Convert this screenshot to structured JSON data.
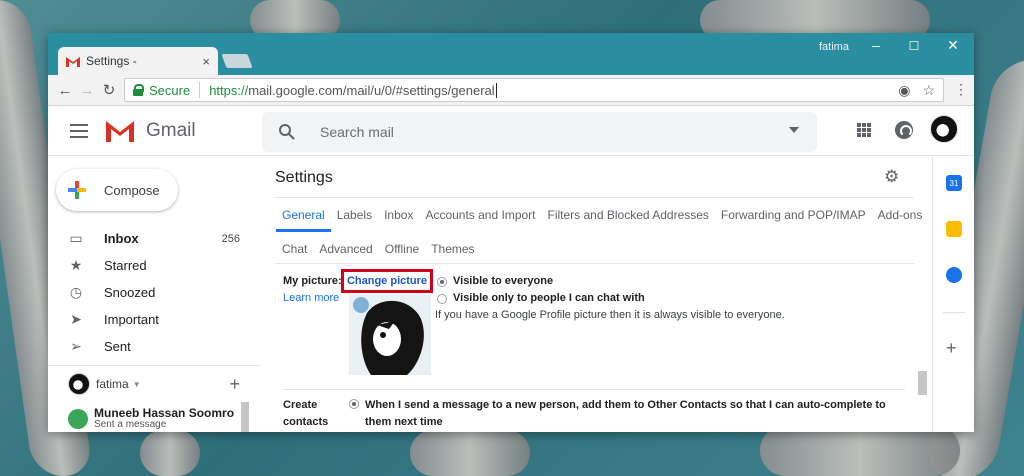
{
  "browser": {
    "tab_title": "Settings - ",
    "tab_close": "×",
    "user": "fatima",
    "minimize": "–",
    "maximize": "☐",
    "close": "✕",
    "back": "←",
    "forward": "→",
    "reload": "↻",
    "secure_label": "Secure",
    "url_scheme": "https://",
    "url_host": "mail.google.com",
    "url_path": "/mail/u/0/#settings/general",
    "menu": "⋮"
  },
  "gmail": {
    "brand": "Gmail",
    "search_placeholder": "Search mail",
    "compose": "Compose",
    "nav": [
      {
        "label": "Inbox",
        "count": "256",
        "icon": "inbox-icon",
        "glyph": "▭"
      },
      {
        "label": "Starred",
        "count": "",
        "icon": "star-icon",
        "glyph": "★"
      },
      {
        "label": "Snoozed",
        "count": "",
        "icon": "clock-icon",
        "glyph": "◷"
      },
      {
        "label": "Important",
        "count": "",
        "icon": "important-icon",
        "glyph": "➤"
      },
      {
        "label": "Sent",
        "count": "",
        "icon": "send-icon",
        "glyph": "➢"
      }
    ],
    "hangouts_user": "fatima",
    "hangouts_plus": "+",
    "contact": {
      "name": "Muneeb Hassan Soomro",
      "status": "Sent a message"
    }
  },
  "settings": {
    "title": "Settings",
    "tabs_row1": [
      "General",
      "Labels",
      "Inbox",
      "Accounts and Import",
      "Filters and Blocked Addresses",
      "Forwarding and POP/IMAP",
      "Add-ons"
    ],
    "tabs_row2": [
      "Chat",
      "Advanced",
      "Offline",
      "Themes"
    ],
    "my_picture_label": "My picture:",
    "change_picture": "Change picture",
    "learn_more": "Learn more",
    "visible_everyone": "Visible to everyone",
    "visible_chat": "Visible only to people I can chat with",
    "picture_note": "If you have a Google Profile picture then it is always visible to everyone.",
    "create_contacts_label": "Create contacts for",
    "create_contacts_option": "When I send a message to a new person, add them to Other Contacts so that I can auto-complete to them next time"
  },
  "rightbar": {
    "calendar_text": "31",
    "plus": "+"
  },
  "colors": {
    "accent": "#1a73e8",
    "highlight_box": "#d0021b",
    "titlebar": "#2b8ea0"
  }
}
